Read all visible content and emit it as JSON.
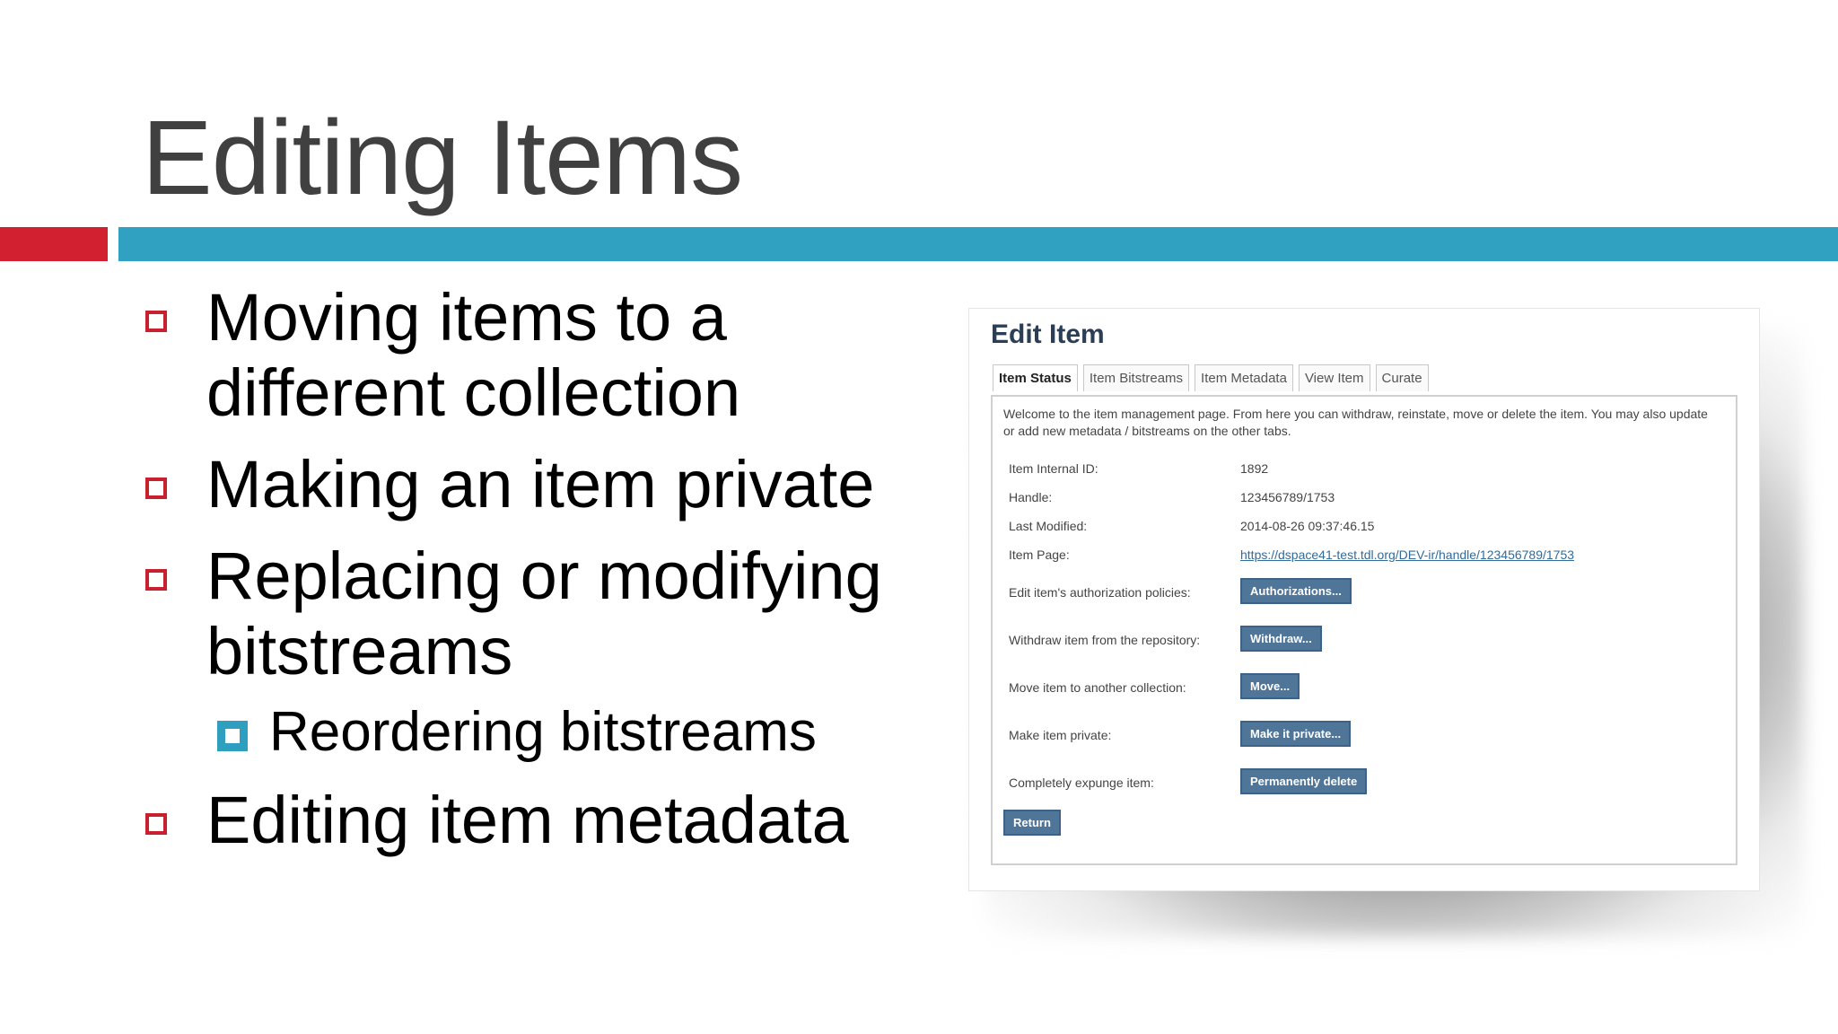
{
  "slide": {
    "title": "Editing Items",
    "bullets": [
      "Moving items to a different collection",
      "Making an item private",
      "Replacing or modifying bitstreams"
    ],
    "subbullet": "Reordering bitstreams",
    "last_bullet": "Editing item metadata",
    "colors": {
      "title": "#404040",
      "accent_red": "#d32030",
      "accent_blue": "#31a1c1"
    }
  },
  "edit_item": {
    "title": "Edit Item",
    "tabs": [
      "Item Status",
      "Item Bitstreams",
      "Item Metadata",
      "View Item",
      "Curate"
    ],
    "intro": "Welcome to the item management page. From here you can withdraw, reinstate, move or delete the item. You may also update or add new metadata / bitstreams on the other tabs.",
    "fields": {
      "internal_id_label": "Item Internal ID:",
      "internal_id_value": "1892",
      "handle_label": "Handle:",
      "handle_value": "123456789/1753",
      "last_modified_label": "Last Modified:",
      "last_modified_value": "2014-08-26 09:37:46.15",
      "item_page_label": "Item Page:",
      "item_page_value": "https://dspace41-test.tdl.org/DEV-ir/handle/123456789/1753"
    },
    "actions": {
      "auth_label": "Edit item's authorization policies:",
      "auth_button": "Authorizations...",
      "withdraw_label": "Withdraw item from the repository:",
      "withdraw_button": "Withdraw...",
      "move_label": "Move item to another collection:",
      "move_button": "Move...",
      "private_label": "Make item private:",
      "private_button": "Make it private...",
      "expunge_label": "Completely expunge item:",
      "expunge_button": "Permanently delete",
      "return_button": "Return"
    },
    "colors": {
      "button_bg": "#4f7599",
      "link": "#336b99",
      "heading": "#2c3e56"
    }
  }
}
